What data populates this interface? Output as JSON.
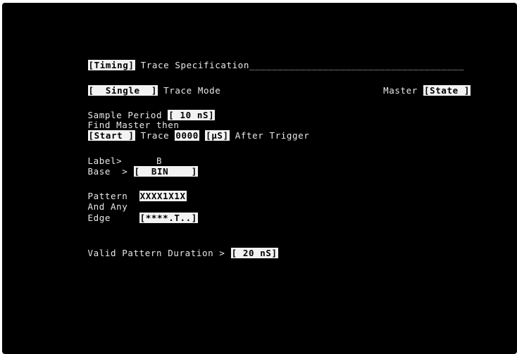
{
  "title": {
    "mode_field": "[Timing]",
    "text": " Trace Specification",
    "rule": "______________________________________"
  },
  "trace_mode": {
    "field": "[  Single  ]",
    "label": " Trace Mode"
  },
  "master": {
    "label": "Master ",
    "field": "[State ]"
  },
  "sample_period": {
    "label": "Sample Period ",
    "field": "[ 10 nS]"
  },
  "find_master": {
    "text": "Find Master then"
  },
  "trace": {
    "start_field": "[Start ]",
    "trace_label": " Trace ",
    "count_field": "0000",
    "unit_field": "[µS]",
    "after_label": " After Trigger"
  },
  "label_row": {
    "label": "Label>",
    "value": "      B"
  },
  "base_row": {
    "label": "Base  > ",
    "field": "[  BIN    ]"
  },
  "pattern_row": {
    "label": "Pattern  ",
    "field": "XXXX1X1X"
  },
  "and_any": {
    "text": "And Any"
  },
  "edge_row": {
    "label": "Edge     ",
    "field": "[****.T..]"
  },
  "valid_duration": {
    "label": "Valid Pattern Duration > ",
    "field": "[ 20 nS]"
  }
}
